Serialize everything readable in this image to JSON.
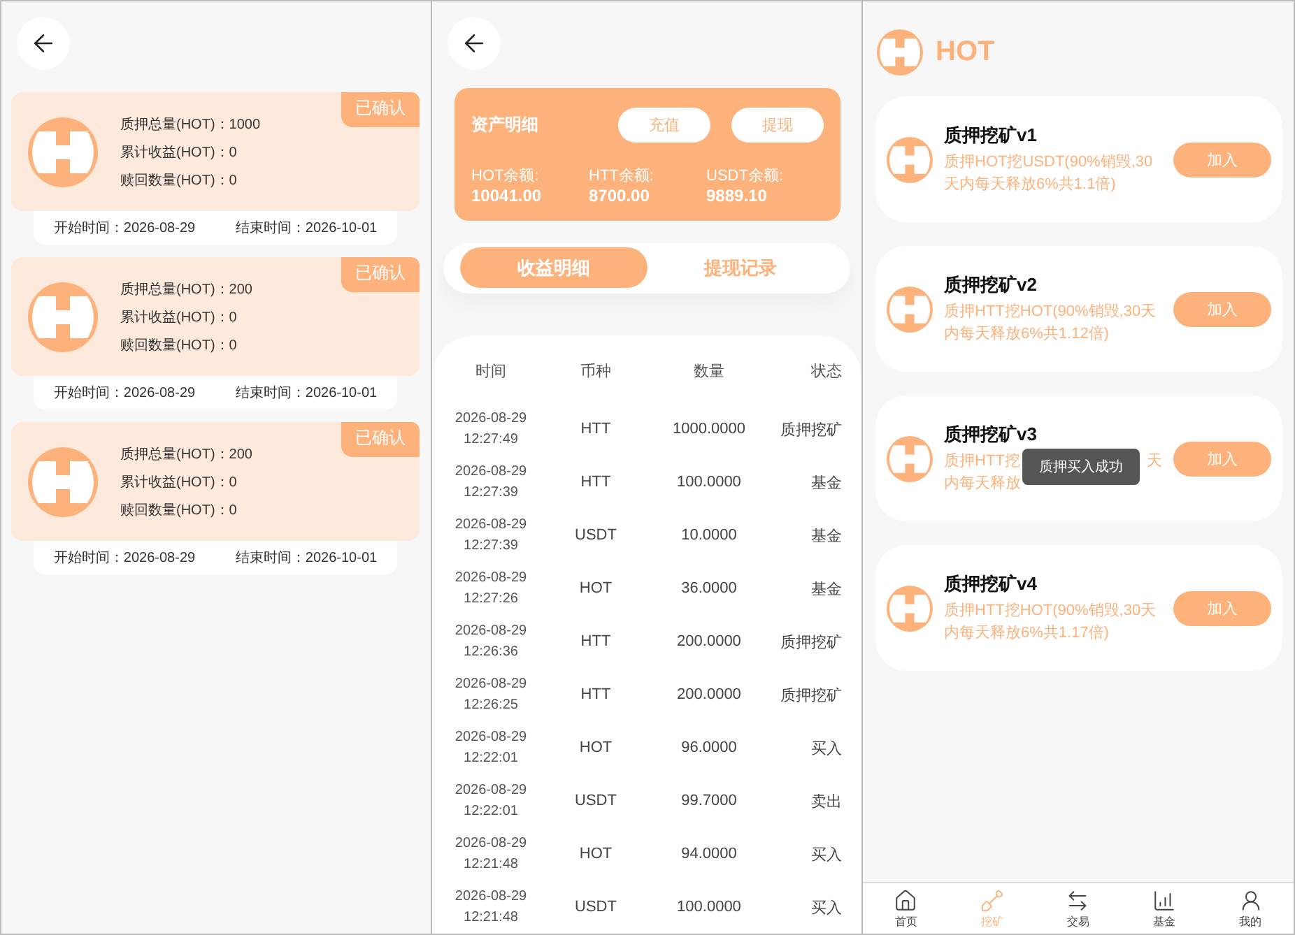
{
  "stakes_screen": {
    "records": [
      {
        "status": "已确认",
        "lines": [
          "质押总量(HOT)：1000",
          "累计收益(HOT)：0",
          "赎回数量(HOT)：0"
        ],
        "start": "开始时间：2026-08-29",
        "end": "结束时间：2026-10-01"
      },
      {
        "status": "已确认",
        "lines": [
          "质押总量(HOT)：200",
          "累计收益(HOT)：0",
          "赎回数量(HOT)：0"
        ],
        "start": "开始时间：2026-08-29",
        "end": "结束时间：2026-10-01"
      },
      {
        "status": "已确认",
        "lines": [
          "质押总量(HOT)：200",
          "累计收益(HOT)：0",
          "赎回数量(HOT)：0"
        ],
        "start": "开始时间：2026-08-29",
        "end": "结束时间：2026-10-01"
      }
    ]
  },
  "assets_screen": {
    "title": "资产明细",
    "buttons": [
      "充值",
      "提现"
    ],
    "balances": [
      {
        "label": "HOT余额:",
        "value": "10041.00"
      },
      {
        "label": "HTT余额:",
        "value": "8700.00"
      },
      {
        "label": "USDT余额:",
        "value": "9889.10"
      }
    ],
    "tabs": [
      {
        "label": "收益明细",
        "selected": true
      },
      {
        "label": "提现记录",
        "selected": false
      }
    ],
    "table": {
      "columns": [
        "时间",
        "币种",
        "数量",
        "状态"
      ],
      "rows": [
        {
          "date": "2026-08-29",
          "time": "12:27:49",
          "coin": "HTT",
          "amount": "1000.0000",
          "status": "质押挖矿"
        },
        {
          "date": "2026-08-29",
          "time": "12:27:39",
          "coin": "HTT",
          "amount": "100.0000",
          "status": "基金"
        },
        {
          "date": "2026-08-29",
          "time": "12:27:39",
          "coin": "USDT",
          "amount": "10.0000",
          "status": "基金"
        },
        {
          "date": "2026-08-29",
          "time": "12:27:26",
          "coin": "HOT",
          "amount": "36.0000",
          "status": "基金"
        },
        {
          "date": "2026-08-29",
          "time": "12:26:36",
          "coin": "HTT",
          "amount": "200.0000",
          "status": "质押挖矿"
        },
        {
          "date": "2026-08-29",
          "time": "12:26:25",
          "coin": "HTT",
          "amount": "200.0000",
          "status": "质押挖矿"
        },
        {
          "date": "2026-08-29",
          "time": "12:22:01",
          "coin": "HOT",
          "amount": "96.0000",
          "status": "买入"
        },
        {
          "date": "2026-08-29",
          "time": "12:22:01",
          "coin": "USDT",
          "amount": "99.7000",
          "status": "卖出"
        },
        {
          "date": "2026-08-29",
          "time": "12:21:48",
          "coin": "HOT",
          "amount": "94.0000",
          "status": "买入"
        },
        {
          "date": "2026-08-29",
          "time": "12:21:48",
          "coin": "USDT",
          "amount": "100.0000",
          "status": "买入"
        }
      ]
    }
  },
  "mining_screen": {
    "brand": "HOT",
    "products": [
      {
        "title": "质押挖矿v1",
        "description": "质押HOT挖USDT(90%销毁,30天内每天释放6%共1.1倍)",
        "button": "加入"
      },
      {
        "title": "质押挖矿v2",
        "description": "质押HTT挖HOT(90%销毁,30天内每天释放6%共1.12倍)",
        "button": "加入"
      },
      {
        "title": "质押挖矿v3",
        "description_lines": [
          {
            "left": "质押HTT挖",
            "right": "天"
          },
          {
            "left": "内每天释放"
          }
        ],
        "button": "加入"
      },
      {
        "title": "质押挖矿v4",
        "description": "质押HTT挖HOT(90%销毁,30天内每天释放6%共1.17倍)",
        "button": "加入"
      }
    ],
    "toast": "质押买入成功",
    "nav": [
      {
        "label": "首页",
        "selected": false
      },
      {
        "label": "挖矿",
        "selected": true
      },
      {
        "label": "交易",
        "selected": false
      },
      {
        "label": "基金",
        "selected": false
      },
      {
        "label": "我的",
        "selected": false
      }
    ]
  }
}
